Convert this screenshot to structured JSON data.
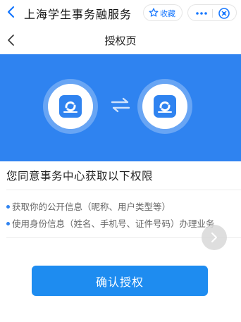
{
  "header": {
    "app_title": "上海学生事务融服务",
    "favorite_label": "收藏"
  },
  "subheader": {
    "page_title": "授权页"
  },
  "main": {
    "heading": "您同意事务中心获取以下权限",
    "permissions": [
      "获取你的公开信息（昵称、用户类型等）",
      "使用身份信息（姓名、手机号、证件号码）办理业务"
    ],
    "confirm_label": "确认授权"
  },
  "colors": {
    "accent": "#2f83f0",
    "button": "#1e8cf0",
    "link": "#1677ff"
  },
  "icons": [
    "back-arrow-icon",
    "star-icon",
    "more-icon",
    "close-circle-icon",
    "app-logo-icon",
    "exchange-arrows-icon",
    "chevron-right-icon"
  ]
}
